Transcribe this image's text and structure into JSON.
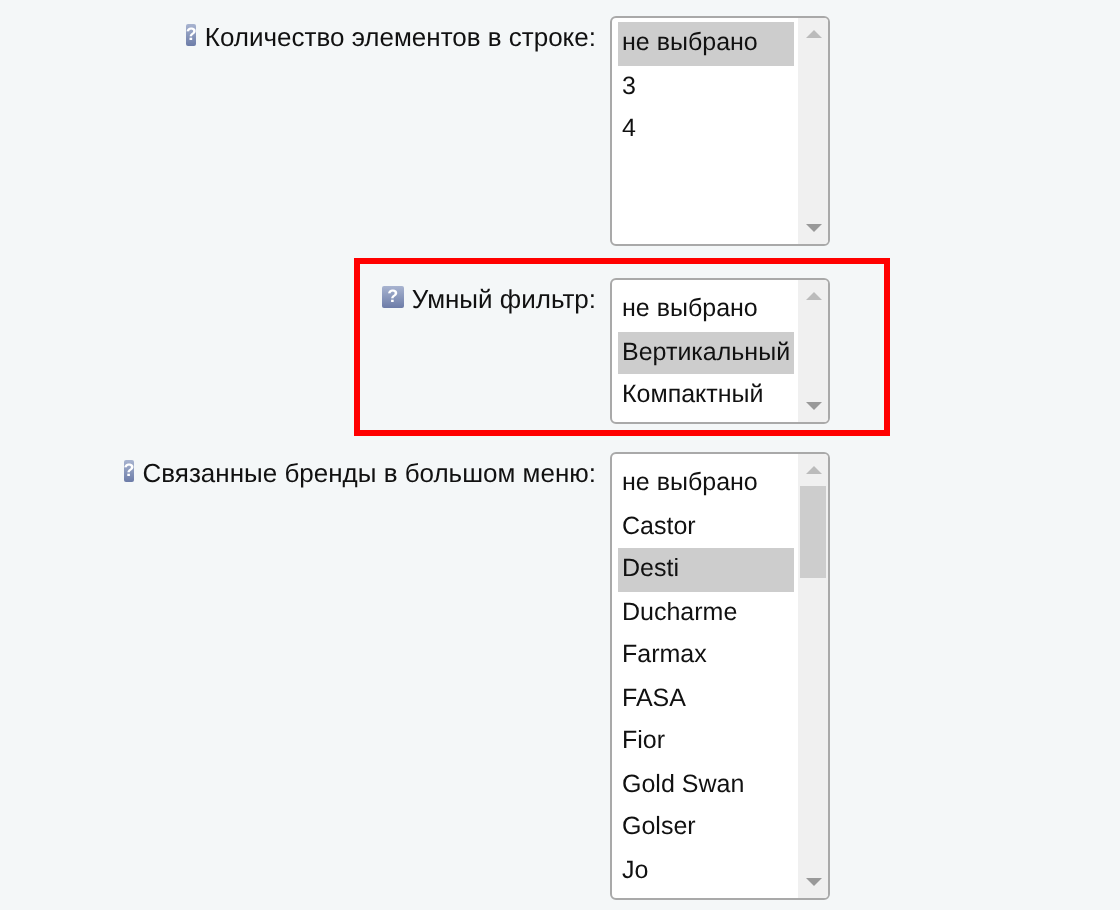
{
  "fields": [
    {
      "help": "?",
      "label": "Количество элементов в строке:",
      "highlighted": false,
      "scroll_thumb": false,
      "options": [
        {
          "label": "не выбрано",
          "selected": true
        },
        {
          "label": "3",
          "selected": false
        },
        {
          "label": "4",
          "selected": false
        }
      ]
    },
    {
      "help": "?",
      "label": "Умный фильтр:",
      "highlighted": true,
      "scroll_thumb": false,
      "options": [
        {
          "label": "не выбрано",
          "selected": false
        },
        {
          "label": "Вертикальный",
          "selected": true
        },
        {
          "label": "Компактный",
          "selected": false
        }
      ]
    },
    {
      "help": "?",
      "label": "Связанные бренды в большом меню:",
      "highlighted": false,
      "scroll_thumb": true,
      "options": [
        {
          "label": "не выбрано",
          "selected": false
        },
        {
          "label": "Castor",
          "selected": false
        },
        {
          "label": "Desti",
          "selected": true
        },
        {
          "label": "Ducharme",
          "selected": false
        },
        {
          "label": "Farmax",
          "selected": false
        },
        {
          "label": "FASA",
          "selected": false
        },
        {
          "label": "Fior",
          "selected": false
        },
        {
          "label": "Gold Swan",
          "selected": false
        },
        {
          "label": "Golser",
          "selected": false
        },
        {
          "label": "Jo",
          "selected": false
        }
      ]
    }
  ]
}
